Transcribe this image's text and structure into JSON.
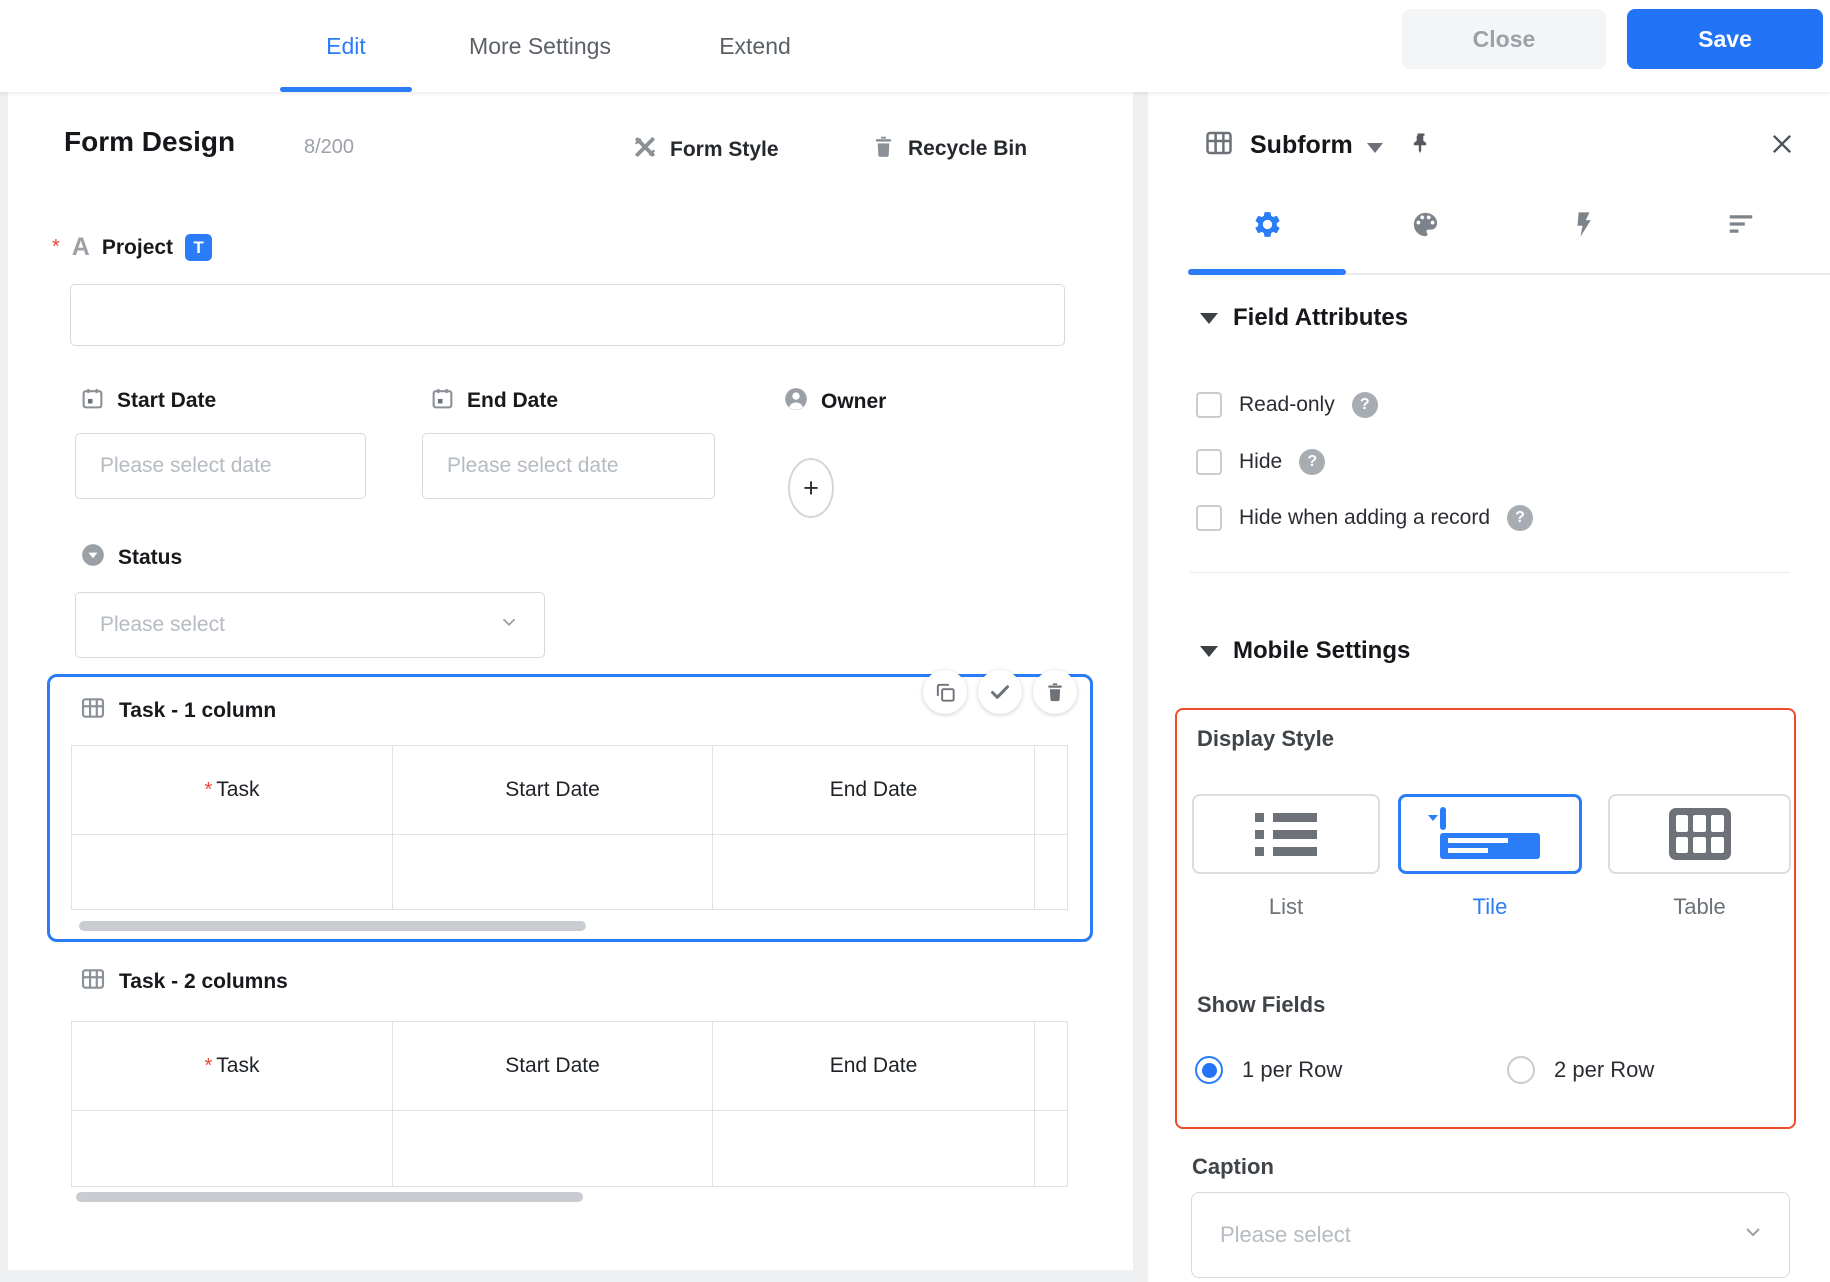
{
  "header": {
    "tabs": [
      {
        "label": "Edit",
        "active": true
      },
      {
        "label": "More Settings",
        "active": false
      },
      {
        "label": "Extend",
        "active": false
      }
    ],
    "close_label": "Close",
    "save_label": "Save"
  },
  "canvas": {
    "title": "Form Design",
    "counter": "8/200",
    "toolbar": {
      "form_style": "Form Style",
      "recycle_bin": "Recycle Bin"
    },
    "project": {
      "required": "*",
      "icon_letter": "A",
      "label": "Project",
      "type_badge": "T",
      "value": ""
    },
    "start_date": {
      "label": "Start Date",
      "placeholder": "Please select date"
    },
    "end_date": {
      "label": "End Date",
      "placeholder": "Please select date"
    },
    "owner": {
      "label": "Owner",
      "add": "+"
    },
    "status": {
      "label": "Status",
      "placeholder": "Please select"
    },
    "subforms": [
      {
        "label": "Task - 1 column",
        "selected": true,
        "required": "*",
        "columns": [
          "Task",
          "Start Date",
          "End Date"
        ]
      },
      {
        "label": "Task - 2 columns",
        "selected": false,
        "required": "*",
        "columns": [
          "Task",
          "Start Date",
          "End Date"
        ]
      }
    ]
  },
  "panel": {
    "title": "Subform",
    "field_attributes": {
      "title": "Field Attributes",
      "options": [
        {
          "label": "Read-only",
          "checked": false,
          "help": "?"
        },
        {
          "label": "Hide",
          "checked": false,
          "help": "?"
        },
        {
          "label": "Hide when adding a record",
          "checked": false,
          "help": "?"
        }
      ]
    },
    "mobile_settings": {
      "title": "Mobile Settings",
      "display_style": {
        "label": "Display Style",
        "options": [
          {
            "label": "List"
          },
          {
            "label": "Tile"
          },
          {
            "label": "Table"
          }
        ],
        "selected": "Tile"
      },
      "show_fields": {
        "label": "Show Fields",
        "options": [
          {
            "label": "1 per Row"
          },
          {
            "label": "2 per Row"
          }
        ],
        "selected": "1 per Row"
      },
      "caption": {
        "label": "Caption",
        "placeholder": "Please select"
      }
    }
  },
  "colors": {
    "accent": "#2b7cf7",
    "save_button": "#2273f5",
    "highlight_border": "#ee4b2b",
    "required": "#f0423a"
  }
}
